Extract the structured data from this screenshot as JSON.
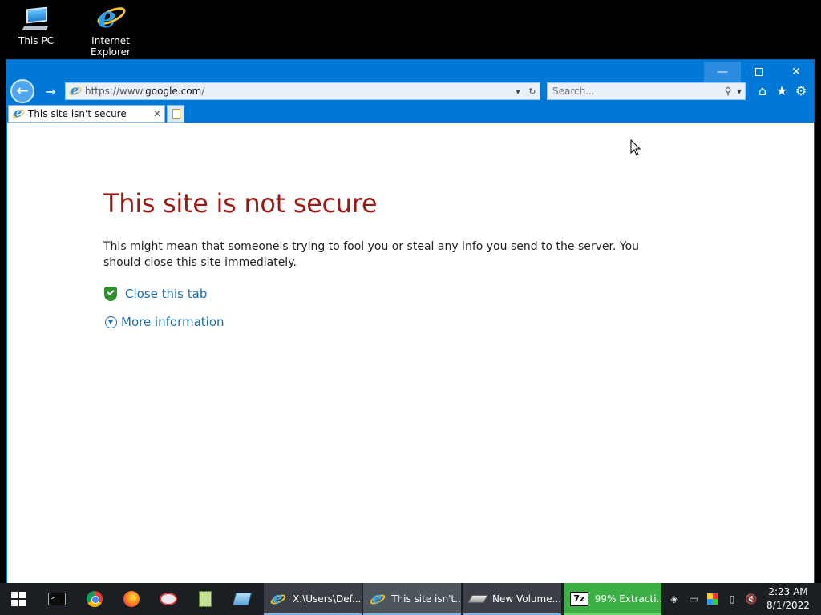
{
  "desktop": {
    "icons": [
      {
        "label": "This PC"
      },
      {
        "label": "Internet Explorer"
      }
    ]
  },
  "browser": {
    "address": {
      "prefix": "https://www.",
      "host": "google.com",
      "path": "/"
    },
    "search_placeholder": "Search...",
    "tab_title": "This site isn't secure",
    "caption": {
      "minimize": "—",
      "close": "✕"
    }
  },
  "page": {
    "title": "This site is not secure",
    "body": "This might mean that someone's trying to fool you or steal any info you send to the server. You should close this site immediately.",
    "close_tab_link": "Close this tab",
    "more_info_link": "More information"
  },
  "taskbar": {
    "apps": [
      {
        "label": "X:\\Users\\Def..."
      },
      {
        "label": "This site isn't..."
      },
      {
        "label": "New Volume..."
      },
      {
        "label": "99% Extracti..."
      }
    ],
    "sevenzip_icon": "7z",
    "clock": {
      "time": "2:23 AM",
      "date": "8/1/2022"
    }
  },
  "colors": {
    "window_chrome": "#0078d7",
    "error_title": "#9c1a16",
    "link": "#1a6fb1",
    "extract_progress": "#3cb044"
  }
}
